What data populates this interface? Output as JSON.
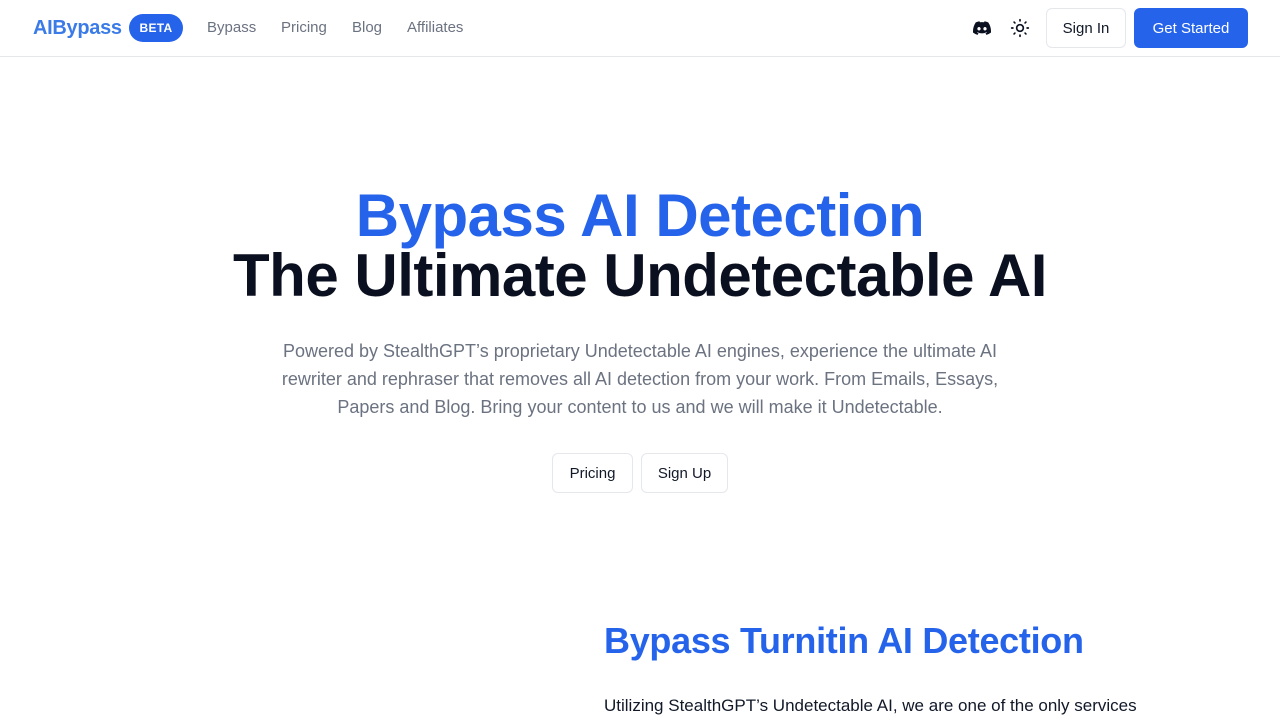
{
  "navbar": {
    "logo": "AIBypass",
    "badge": "BETA",
    "links": [
      "Bypass",
      "Pricing",
      "Blog",
      "Affiliates"
    ],
    "icons": {
      "discord": "discord-icon",
      "theme_toggle": "sun-icon"
    },
    "sign_in_label": "Sign In",
    "get_started_label": "Get Started"
  },
  "hero": {
    "title_line_1": "Bypass AI Detection",
    "title_line_2": "The Ultimate Undetectable AI",
    "description": "Powered by StealthGPT’s proprietary Undetectable AI engines, experience the ultimate AI rewriter and rephraser that removes all AI detection from your work. From Emails, Essays, Papers and Blog. Bring your content to us and we will make it Undetectable.",
    "buttons": [
      "Pricing",
      "Sign Up"
    ]
  },
  "feature_section": {
    "title": "Bypass Turnitin AI Detection",
    "text": "Utilizing StealthGPT’s Undetectable AI, we are one of the only services"
  },
  "colors": {
    "accent": "#2563eb",
    "logo": "#3b7be8",
    "heading_dark": "#0b1020",
    "muted_text": "#6b7280",
    "border": "#e5e7eb"
  }
}
